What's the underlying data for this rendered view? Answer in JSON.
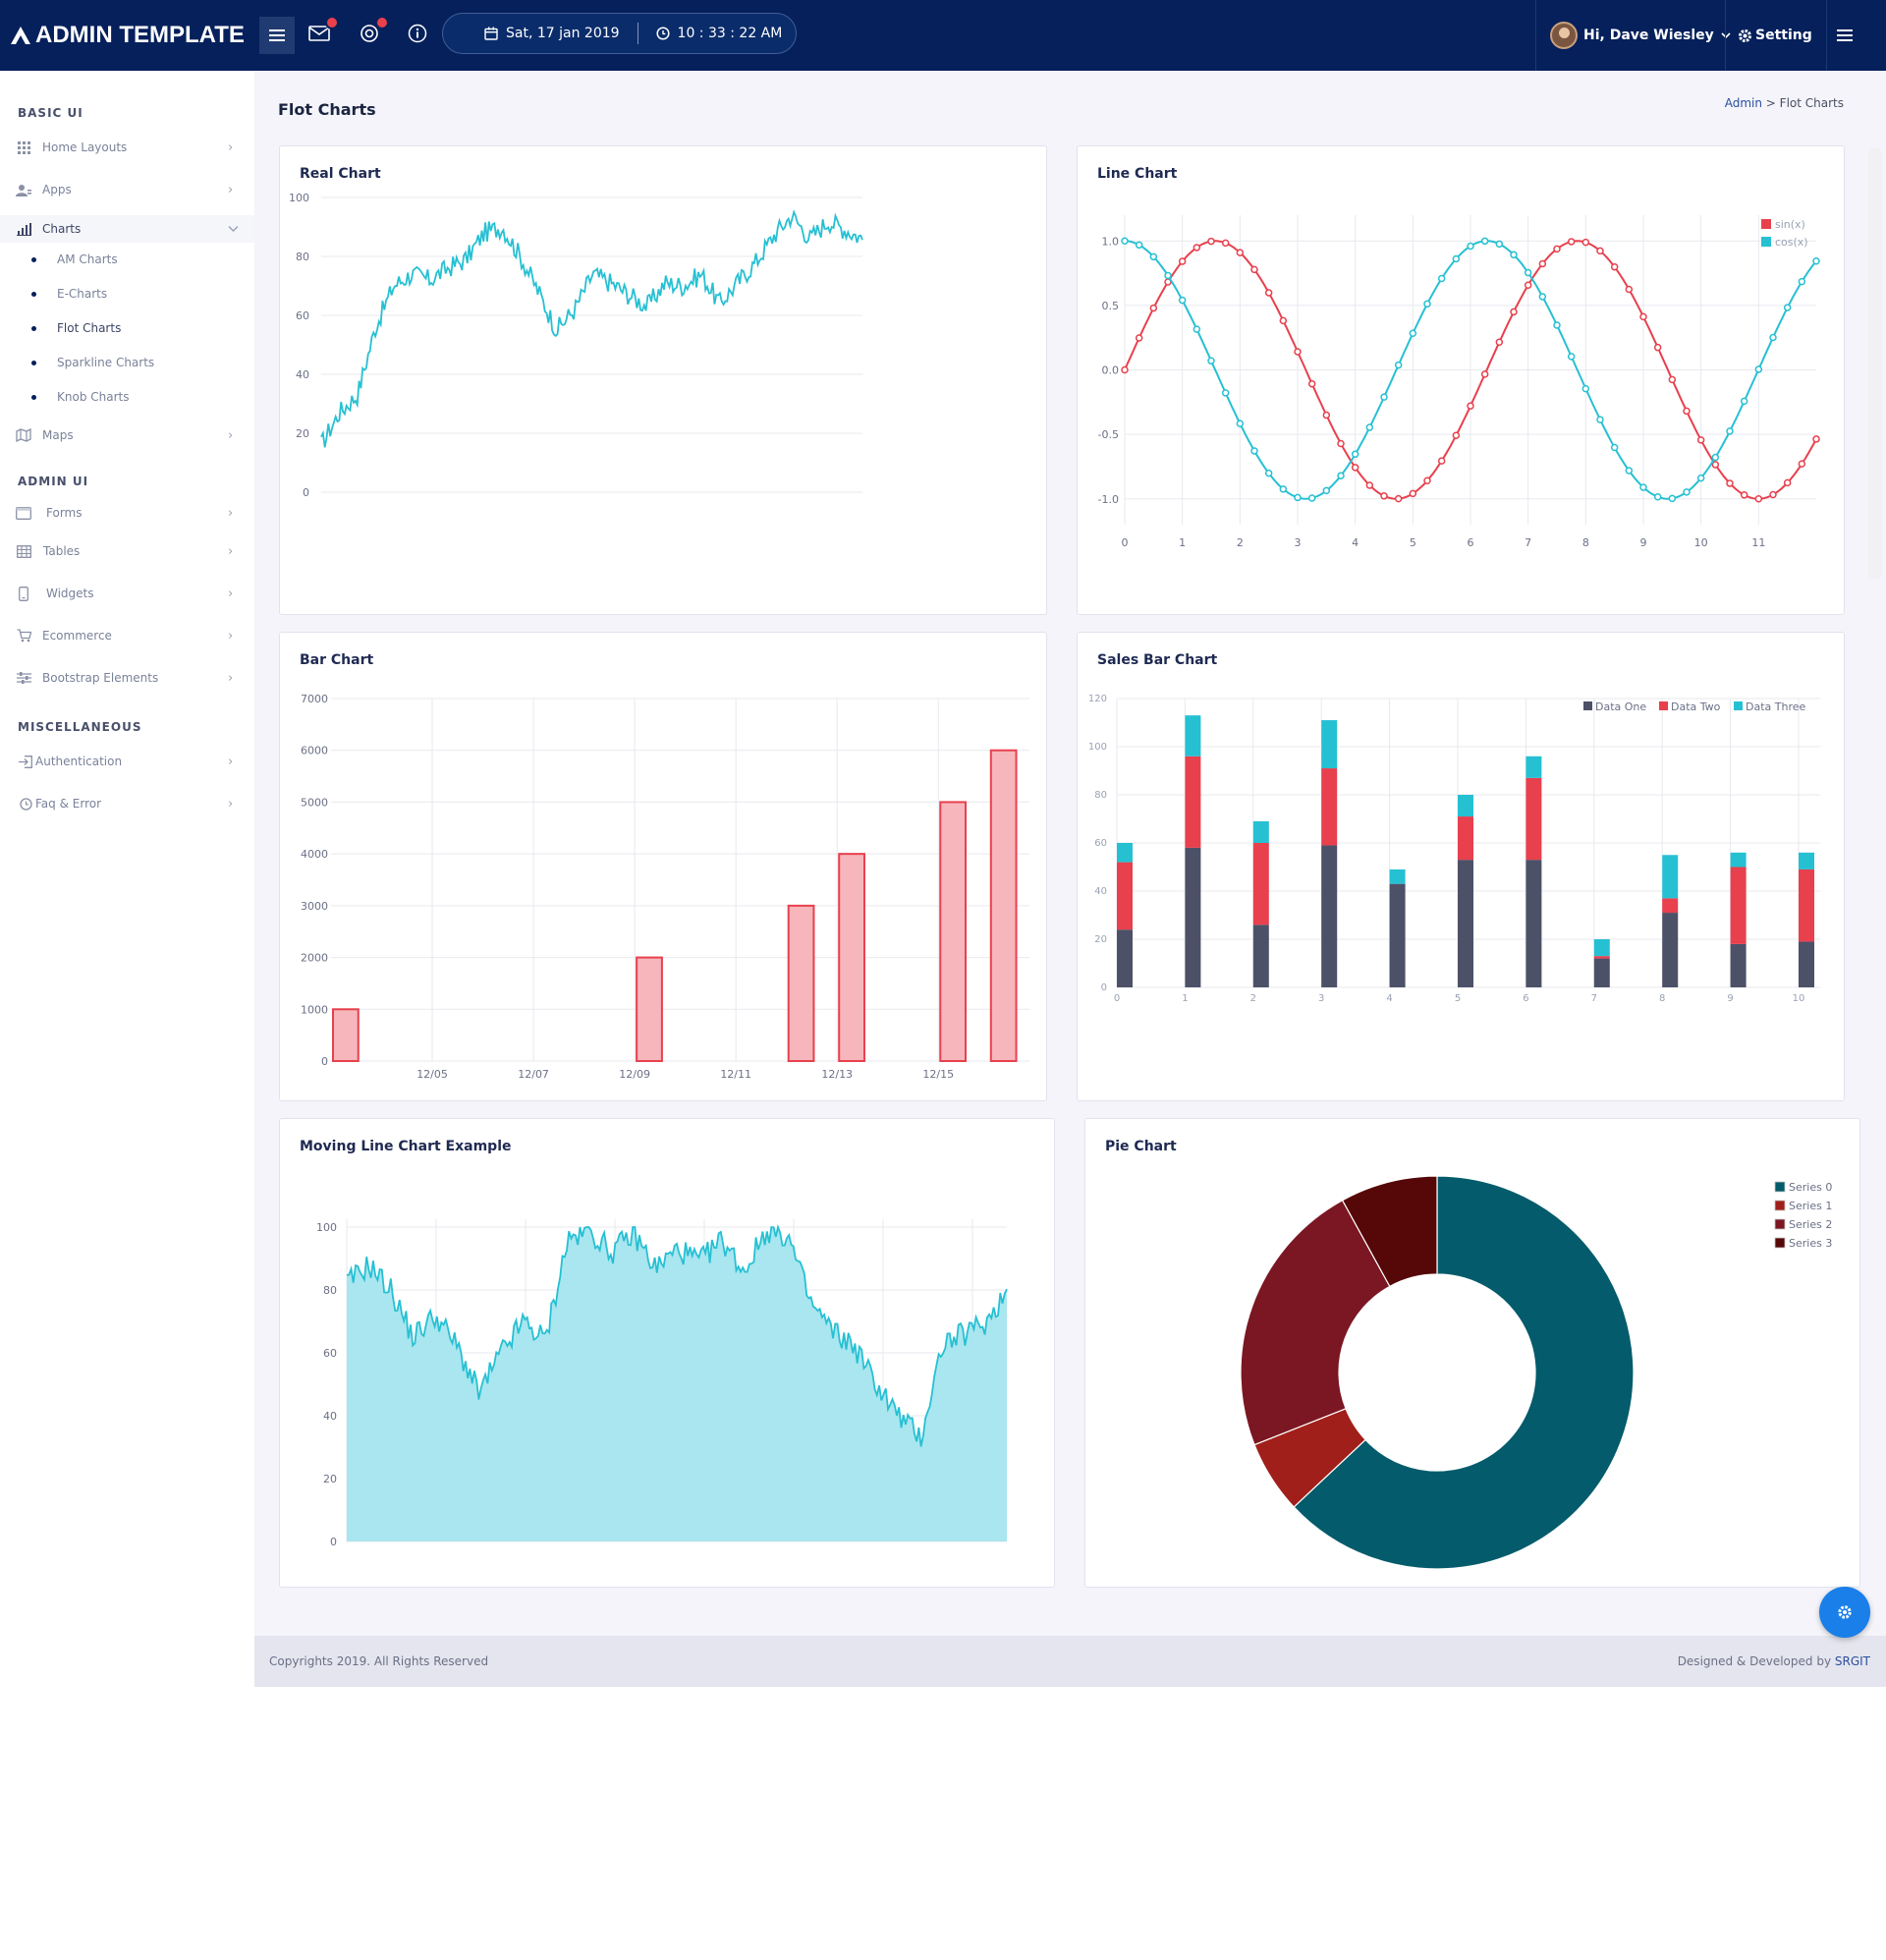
{
  "header": {
    "brand": "ADMIN TEMPLATE",
    "date": "Sat, 17 jan 2019",
    "time": "10 : 33 : 22 AM",
    "user_greeting": "Hi, Dave Wiesley",
    "setting_label": "Setting"
  },
  "sidebar": {
    "sections": [
      "BASIC UI",
      "ADMIN UI",
      "MISCELLANEOUS"
    ],
    "basic_items": [
      {
        "label": "Home Layouts",
        "icon": "grid-icon"
      },
      {
        "label": "Apps",
        "icon": "users-icon"
      },
      {
        "label": "Charts",
        "icon": "bar-chart-icon"
      }
    ],
    "chart_sub": [
      "AM Charts",
      "E-Charts",
      "Flot Charts",
      "Sparkline Charts",
      "Knob Charts"
    ],
    "maps_label": "Maps",
    "admin_items": [
      "Forms",
      "Tables",
      "Widgets",
      "Ecommerce",
      "Bootstrap Elements"
    ],
    "misc_items": [
      "Authentication",
      "Faq & Error"
    ]
  },
  "page": {
    "title": "Flot Charts",
    "breadcrumb_root": "Admin",
    "breadcrumb_sep": ">",
    "breadcrumb_current": "Flot Charts"
  },
  "colors": {
    "accent": "#05205b",
    "cyan": "#26c0d3",
    "red": "#e8404d",
    "navy": "#4d5168"
  },
  "chart_data": [
    {
      "title": "Real Chart",
      "type": "line",
      "ylim": [
        0,
        100
      ],
      "yticks": [
        0,
        20,
        40,
        60,
        80,
        100
      ],
      "x": [
        0,
        10,
        20,
        30,
        40,
        50,
        60,
        70,
        80,
        90,
        100,
        110,
        120,
        130,
        140,
        150,
        160,
        170,
        180,
        190,
        200,
        210,
        220,
        230,
        240,
        250,
        260,
        270,
        280,
        290,
        299
      ],
      "values": [
        16,
        27,
        33,
        56,
        70,
        74,
        72,
        76,
        79,
        88,
        90,
        80,
        68,
        55,
        62,
        74,
        71,
        67,
        63,
        71,
        70,
        74,
        64,
        71,
        78,
        87,
        94,
        86,
        92,
        89,
        86
      ],
      "color": "#26c0d3"
    },
    {
      "title": "Line Chart",
      "type": "line",
      "ylim": [
        -1.2,
        1.2
      ],
      "yticks": [
        -1.0,
        -0.5,
        0.0,
        0.5,
        1.0
      ],
      "xticks": [
        0,
        1,
        2,
        3,
        4,
        5,
        6,
        7,
        8,
        9,
        10,
        11
      ],
      "series": [
        {
          "name": "sin(x)",
          "function": "sin",
          "x_range": [
            0,
            12
          ],
          "step": 0.25,
          "color": "#e8404d"
        },
        {
          "name": "cos(x)",
          "function": "cos",
          "x_range": [
            0,
            12
          ],
          "step": 0.25,
          "color": "#26c0d3"
        }
      ],
      "legend": "top-right"
    },
    {
      "title": "Bar Chart",
      "type": "bar",
      "ylim": [
        0,
        7000
      ],
      "yticks": [
        0,
        1000,
        2000,
        3000,
        4000,
        5000,
        6000,
        7000
      ],
      "xticks": [
        "12/05",
        "12/07",
        "12/09",
        "12/11",
        "12/13",
        "12/15"
      ],
      "days": [
        3,
        9,
        12,
        13,
        15,
        16
      ],
      "values": [
        1000,
        2000,
        3000,
        4000,
        5000,
        6000
      ],
      "day_range": [
        3,
        16.8
      ],
      "color": "#e8404d"
    },
    {
      "title": "Sales Bar Chart",
      "type": "bar",
      "stacked": true,
      "ylim": [
        0,
        120
      ],
      "yticks": [
        0,
        20,
        40,
        60,
        80,
        100,
        120
      ],
      "categories": [
        "0",
        "1",
        "2",
        "3",
        "4",
        "5",
        "6",
        "7",
        "8",
        "9",
        "10"
      ],
      "series": [
        {
          "name": "Data One",
          "values": [
            24,
            58,
            26,
            59,
            43,
            53,
            53,
            12,
            31,
            18,
            19
          ],
          "color": "#4d5168"
        },
        {
          "name": "Data Two",
          "values": [
            28,
            38,
            34,
            32,
            0,
            18,
            34,
            1,
            6,
            32,
            30
          ],
          "color": "#e8404d"
        },
        {
          "name": "Data Three",
          "values": [
            8,
            17,
            9,
            20,
            6,
            9,
            9,
            7,
            18,
            6,
            7
          ],
          "color": "#26c0d3"
        }
      ],
      "legend": "top-right"
    },
    {
      "title": "Moving Line Chart Example",
      "type": "area",
      "ylim": [
        0,
        100
      ],
      "yticks": [
        0,
        20,
        40,
        60,
        80,
        100
      ],
      "x": [
        0,
        10,
        20,
        30,
        40,
        50,
        60,
        70,
        80,
        90,
        100,
        110,
        120,
        130,
        140,
        150,
        160,
        170,
        180,
        190,
        200,
        210,
        220,
        230,
        240,
        250,
        260,
        270,
        280,
        290,
        299
      ],
      "values": [
        82,
        88,
        80,
        65,
        72,
        62,
        47,
        60,
        70,
        64,
        96,
        99,
        92,
        98,
        87,
        93,
        89,
        96,
        86,
        99,
        97,
        76,
        67,
        62,
        50,
        40,
        33,
        63,
        66,
        70,
        80
      ],
      "color": "#26c0d3"
    },
    {
      "title": "Pie Chart",
      "type": "pie",
      "donut": true,
      "series": [
        {
          "name": "Series 0",
          "value": 63,
          "color": "#035b6b"
        },
        {
          "name": "Series 1",
          "value": 6,
          "color": "#a11f1a"
        },
        {
          "name": "Series 2",
          "value": 23,
          "color": "#7a1722"
        },
        {
          "name": "Series 3",
          "value": 8,
          "color": "#560707"
        }
      ],
      "legend": "top-right"
    }
  ],
  "footer": {
    "copyright": "Copyrights 2019. All Rights Reserved",
    "designed_prefix": "Designed & Developed by",
    "designed_by": "SRGIT"
  }
}
